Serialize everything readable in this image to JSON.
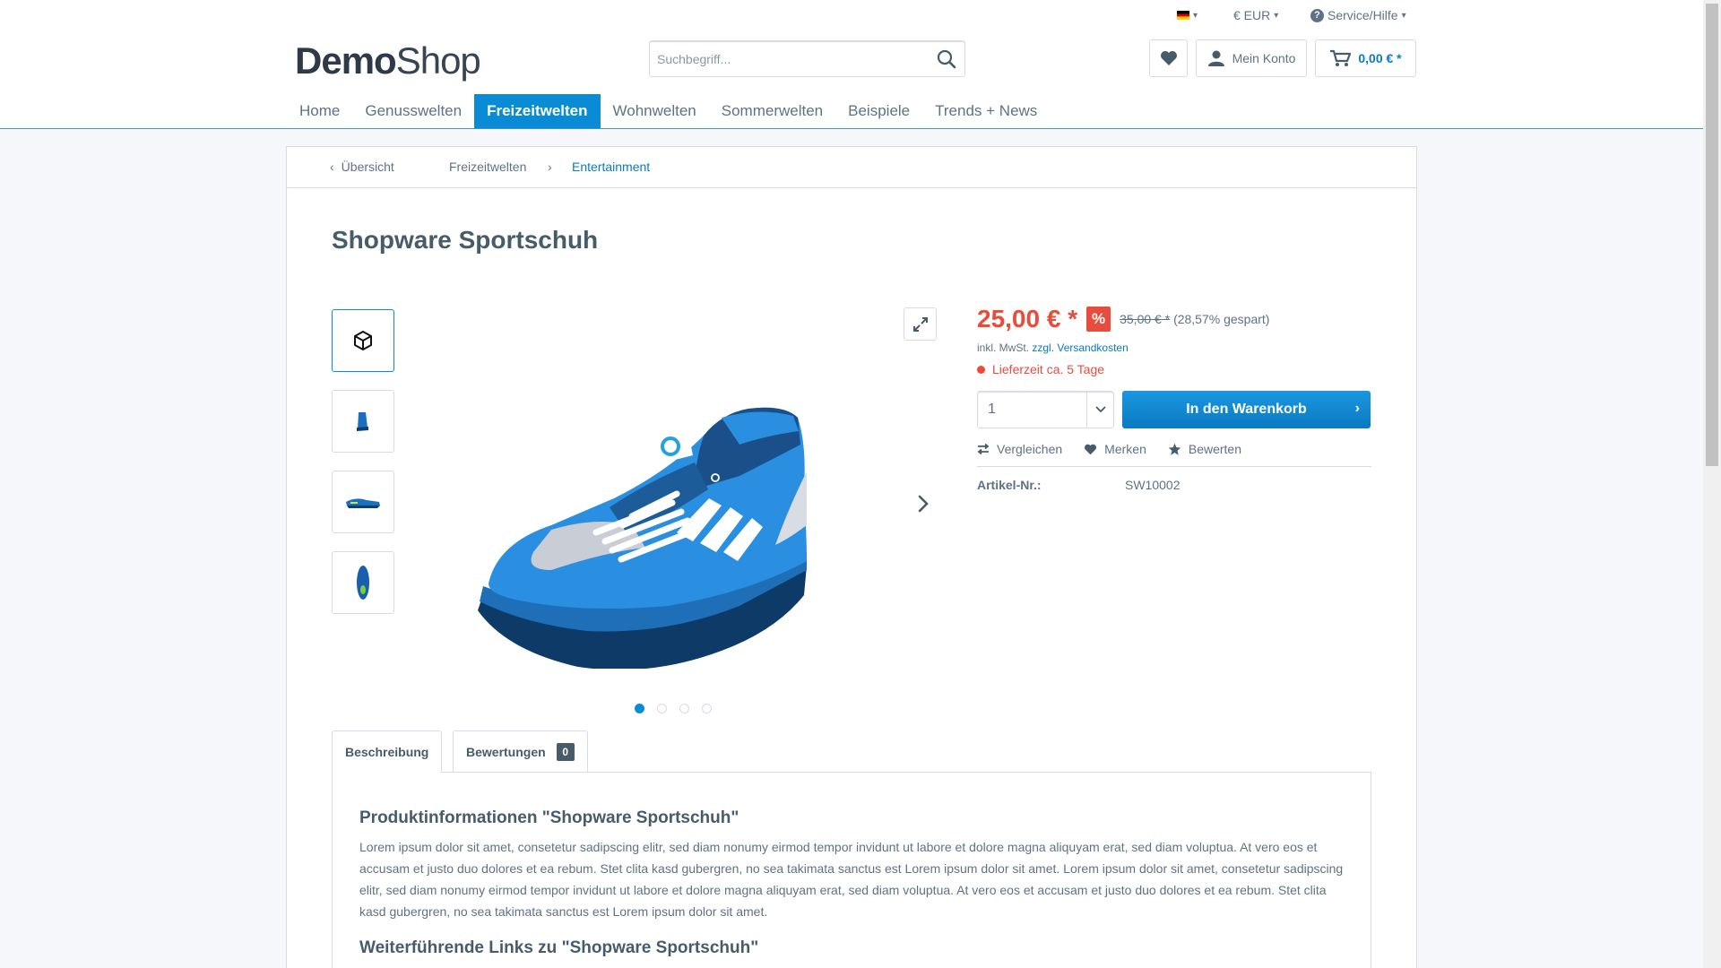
{
  "topbar": {
    "language_caret": "⌄",
    "currency": "€ EUR",
    "service": "Service/Hilfe"
  },
  "logo": {
    "part1": "Demo",
    "part2": "Shop"
  },
  "search": {
    "placeholder": "Suchbegriff..."
  },
  "account": {
    "label": "Mein Konto"
  },
  "cart": {
    "amount": "0,00 € *"
  },
  "nav": {
    "items": [
      "Home",
      "Genusswelten",
      "Freizeitwelten",
      "Wohnwelten",
      "Sommerwelten",
      "Beispiele",
      "Trends + News"
    ],
    "active": "Freizeitwelten"
  },
  "breadcrumb": {
    "back": "Übersicht",
    "items": [
      "Freizeitwelten",
      "Entertainment"
    ]
  },
  "product": {
    "title": "Shopware Sportschuh",
    "price": "25,00 € *",
    "sale_badge": "%",
    "old_price": "35,00 € *",
    "savings": "(28,57% gespart)",
    "tax_text": "inkl. MwSt.",
    "shipping_link": "zzgl. Versandkosten",
    "delivery": "Lieferzeit ca. 5 Tage",
    "quantity": "1",
    "add_to_cart": "In den Warenkorb",
    "actions": {
      "compare": "Vergleichen",
      "remember": "Merken",
      "rate": "Bewerten"
    },
    "article_label": "Artikel-Nr.:",
    "article_number": "SW10002"
  },
  "gallery": {
    "active_index": 0,
    "dot_count": 4
  },
  "tabs": {
    "description": "Beschreibung",
    "reviews": "Bewertungen",
    "reviews_count": "0"
  },
  "description": {
    "heading": "Produktinformationen \"Shopware Sportschuh\"",
    "text": "Lorem ipsum dolor sit amet, consetetur sadipscing elitr, sed diam nonumy eirmod tempor invidunt ut labore et dolore magna aliquyam erat, sed diam voluptua. At vero eos et accusam et justo duo dolores et ea rebum. Stet clita kasd gubergren, no sea takimata sanctus est Lorem ipsum dolor sit amet. Lorem ipsum dolor sit amet, consetetur sadipscing elitr, sed diam nonumy eirmod tempor invidunt ut labore et dolore magna aliquyam erat, sed diam voluptua. At vero eos et accusam et justo duo dolores et ea rebum. Stet clita kasd gubergren, no sea takimata sanctus est Lorem ipsum dolor sit amet.",
    "links_heading": "Weiterführende Links zu \"Shopware Sportschuh\""
  },
  "colors": {
    "accent": "#0a8bd6",
    "link": "#0a7ac2",
    "price": "#e74c3c",
    "text": "#5f7285",
    "heading": "#475c6a"
  }
}
